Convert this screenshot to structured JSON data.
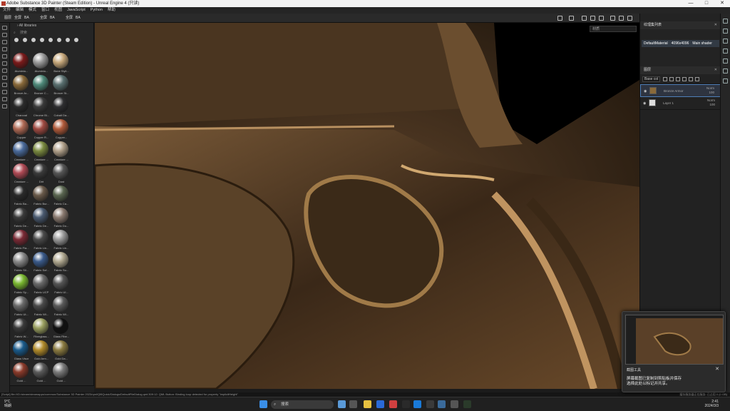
{
  "window": {
    "title": "Adobe Substance 3D Painter (Steam Edition) - Unreal Engine 4 (只读)",
    "minimize": "—",
    "maximize": "□",
    "close": "✕"
  },
  "menu": [
    "文件",
    "编辑",
    "模式",
    "窗口",
    "视图",
    "JavaScript",
    "Python",
    "帮助"
  ],
  "toolbar": {
    "items": [
      "图层",
      "全屏",
      "BA",
      "全屏",
      "BA",
      "全屏",
      "BA"
    ]
  },
  "shelf": {
    "header": "All libraries",
    "search_placeholder": "搜索",
    "materials": [
      {
        "name": "Aluminiu...",
        "color": "#7a1a1a"
      },
      {
        "name": "Aluminiu...",
        "color": "#9a9a9a"
      },
      {
        "name": "Bone Styli...",
        "color": "#c6a77a"
      },
      {
        "name": "Bronze Ar...",
        "color": "#8a6a3a"
      },
      {
        "name": "Bronze C...",
        "color": "#4f8a7a"
      },
      {
        "name": "Bronze St...",
        "color": "#5a7070"
      },
      {
        "name": "Charcoal",
        "color": "#2b2b2b"
      },
      {
        "name": "Chrome Bl...",
        "color": "#3a3a3a"
      },
      {
        "name": "Cobalt Da...",
        "color": "#2e2e30"
      },
      {
        "name": "Copper",
        "color": "#b06a55"
      },
      {
        "name": "Copper R...",
        "color": "#a04a42"
      },
      {
        "name": "Copper...",
        "color": "#b05a3a"
      },
      {
        "name": "Creature ...",
        "color": "#4a6a9a"
      },
      {
        "name": "Creature ...",
        "color": "#7a8a40"
      },
      {
        "name": "Creature ...",
        "color": "#b0a08a"
      },
      {
        "name": "Creature ...",
        "color": "#b04a55"
      },
      {
        "name": "Dirt",
        "color": "#3a3a3a"
      },
      {
        "name": "Dust",
        "color": "#555"
      },
      {
        "name": "Fabric Ba...",
        "color": "#2a2a2a"
      },
      {
        "name": "Fabric Bur...",
        "color": "#6a5a4a"
      },
      {
        "name": "Fabric Ca...",
        "color": "#5a6650"
      },
      {
        "name": "Fabric De...",
        "color": "#3a3a3a"
      },
      {
        "name": "Fabric De...",
        "color": "#4a5a70"
      },
      {
        "name": "Fabric Do...",
        "color": "#8a7a70"
      },
      {
        "name": "Fabric Fla...",
        "color": "#7a2a35"
      },
      {
        "name": "Fabric Lin...",
        "color": "#4a4a4a"
      },
      {
        "name": "Fabric Lin...",
        "color": "#9a9a9a"
      },
      {
        "name": "Fabric Sil...",
        "color": "#8a8a8a"
      },
      {
        "name": "Fabric Sof...",
        "color": "#3a5a8a"
      },
      {
        "name": "Fabric Su...",
        "color": "#b0a890"
      },
      {
        "name": "Fabric Sy...",
        "color": "#7ab830"
      },
      {
        "name": "Fabric UCP",
        "color": "#6a6a6a"
      },
      {
        "name": "Fabric Ul...",
        "color": "#555"
      },
      {
        "name": "Fabric Ut...",
        "color": "#6a6a6a"
      },
      {
        "name": "Fabric Wl...",
        "color": "#4a4a4a"
      },
      {
        "name": "Fabric Wl...",
        "color": "#5a5a5a"
      },
      {
        "name": "Fabric W...",
        "color": "#3a3a3a"
      },
      {
        "name": "Fiberglass...",
        "color": "#9aa060"
      },
      {
        "name": "Glass Fibe...",
        "color": "#111"
      },
      {
        "name": "Glass Visor",
        "color": "#1a5a8a"
      },
      {
        "name": "Gold Arm...",
        "color": "#b08a2a"
      },
      {
        "name": "Gold Da...",
        "color": "#8a7a40"
      },
      {
        "name": "Gold ...",
        "color": "#8a3a2a"
      },
      {
        "name": "Gold ...",
        "color": "#5a5a5a"
      },
      {
        "name": "Gold ...",
        "color": "#7a7a7a"
      }
    ]
  },
  "viewport": {
    "mode": "材质"
  },
  "texture_set": {
    "title": "纹理集列表",
    "material": "DefaultMaterial",
    "size": "4096x4096",
    "shader": "Main shader"
  },
  "layers_panel": {
    "title": "图层",
    "channel": "Base col",
    "layers": [
      {
        "name": "Bronze Armor",
        "blend": "Norm",
        "opacity": "100"
      },
      {
        "name": "Layer 1",
        "blend": "Norm",
        "opacity": "100"
      }
    ]
  },
  "status": {
    "log": "[Script] file:///D:/steam/steamapps/common/Substance 3D Painter 2023/qml/Qt5Quick/Dialogs/DefaultFileDialog.qml:309:12: QML Button: Binding loop detected for property \"implicitHeight\"",
    "right": "缓存服务器正在服务: 已占用 0 (0 GB)"
  },
  "taskbar": {
    "weather_temp": "9°C",
    "weather_desc": "晴朗",
    "search": "搜索",
    "time": "2:41",
    "date": "2024/3/3"
  },
  "notification": {
    "app": "截图工具",
    "line1": "屏幕截图已复制到剪贴板并保存",
    "line2": "选择此处以标记并共享。"
  }
}
